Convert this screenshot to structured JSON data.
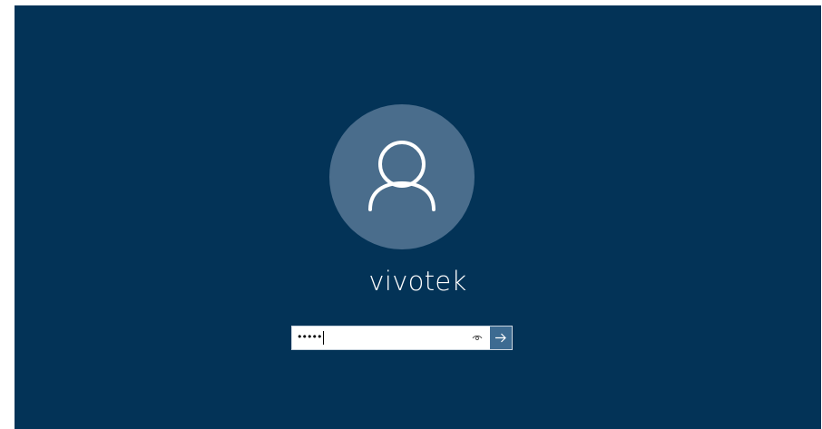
{
  "user": {
    "name": "vivotek",
    "avatar_icon": "user-silhouette-icon"
  },
  "password": {
    "masked_value": "•••••",
    "reveal_icon": "eye-icon",
    "submit_icon": "arrow-right-icon"
  },
  "colors": {
    "background": "#033357",
    "avatar_circle": "#4a6d8c",
    "submit_button": "#3d6b91",
    "text": "#ffffff"
  }
}
